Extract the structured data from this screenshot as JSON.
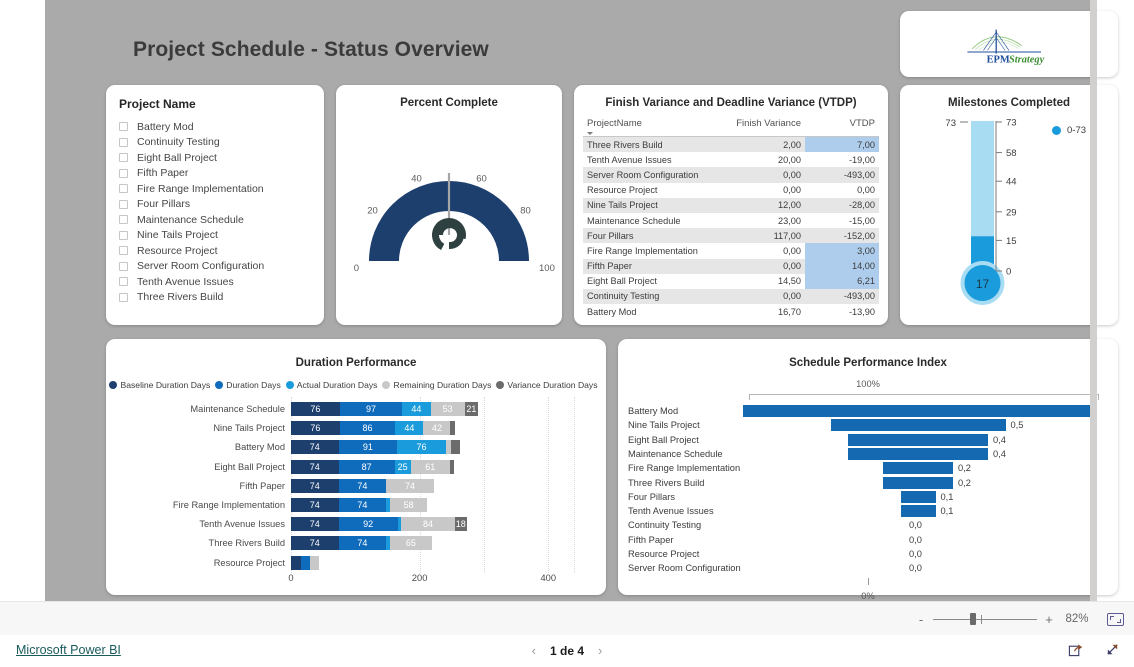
{
  "report": {
    "title": "Project Schedule - Status Overview",
    "logo": {
      "name": "epmstrategy-logo",
      "primary_text": "EPM",
      "secondary_text": "Strategy",
      "primary_color": "#1f4e9c",
      "secondary_color": "#4a9c3f"
    }
  },
  "slicer": {
    "title": "Project Name",
    "items": [
      {
        "label": "Battery Mod",
        "checked": false
      },
      {
        "label": "Continuity Testing",
        "checked": false
      },
      {
        "label": "Eight Ball Project",
        "checked": false
      },
      {
        "label": "Fifth Paper",
        "checked": false
      },
      {
        "label": "Fire Range Implementation",
        "checked": false
      },
      {
        "label": "Four Pillars",
        "checked": false
      },
      {
        "label": "Maintenance Schedule",
        "checked": false
      },
      {
        "label": "Nine Tails Project",
        "checked": false
      },
      {
        "label": "Resource Project",
        "checked": false
      },
      {
        "label": "Server Room Configuration",
        "checked": false
      },
      {
        "label": "Tenth Avenue Issues",
        "checked": false
      },
      {
        "label": "Three Rivers Build",
        "checked": false
      }
    ]
  },
  "table": {
    "title": "Finish Variance and Deadline Variance (VTDP)",
    "columns": [
      "ProjectName",
      "Finish Variance",
      "VTDP"
    ],
    "sorted_column": "ProjectName",
    "highlight_color": "#aecdec",
    "rows": [
      {
        "project": "Three Rivers Build",
        "finish_variance": "2,00",
        "vtdp": "7,00",
        "vtdp_highlight": true
      },
      {
        "project": "Tenth Avenue Issues",
        "finish_variance": "20,00",
        "vtdp": "-19,00",
        "vtdp_highlight": false
      },
      {
        "project": "Server Room Configuration",
        "finish_variance": "0,00",
        "vtdp": "-493,00",
        "vtdp_highlight": false
      },
      {
        "project": "Resource Project",
        "finish_variance": "0,00",
        "vtdp": "0,00",
        "vtdp_highlight": false
      },
      {
        "project": "Nine Tails Project",
        "finish_variance": "12,00",
        "vtdp": "-28,00",
        "vtdp_highlight": false
      },
      {
        "project": "Maintenance Schedule",
        "finish_variance": "23,00",
        "vtdp": "-15,00",
        "vtdp_highlight": false
      },
      {
        "project": "Four Pillars",
        "finish_variance": "117,00",
        "vtdp": "-152,00",
        "vtdp_highlight": false
      },
      {
        "project": "Fire Range Implementation",
        "finish_variance": "0,00",
        "vtdp": "3,00",
        "vtdp_highlight": true
      },
      {
        "project": "Fifth Paper",
        "finish_variance": "0,00",
        "vtdp": "14,00",
        "vtdp_highlight": true
      },
      {
        "project": "Eight Ball Project",
        "finish_variance": "14,50",
        "vtdp": "6,21",
        "vtdp_highlight": true
      },
      {
        "project": "Continuity Testing",
        "finish_variance": "0,00",
        "vtdp": "-493,00",
        "vtdp_highlight": false
      },
      {
        "project": "Battery Mod",
        "finish_variance": "16,70",
        "vtdp": "-13,90",
        "vtdp_highlight": false
      }
    ]
  },
  "chart_data": [
    {
      "id": "percent_complete_gauge",
      "type": "gauge",
      "title": "Percent Complete",
      "value": 50,
      "value_label": "50",
      "min": 0,
      "max": 100,
      "ticks": [
        0,
        20,
        40,
        60,
        80,
        100
      ],
      "tick_labels": [
        "0",
        "20",
        "40",
        "60",
        "80",
        "100"
      ],
      "arc_color": "#1c3f6e",
      "needle_color": "#9a9a9a"
    },
    {
      "id": "milestones_completed_thermometer",
      "type": "thermometer",
      "title": "Milestones Completed",
      "value": 17,
      "value_label": "17",
      "min": 0,
      "max": 73,
      "left_label": "73",
      "ticks": [
        0,
        15,
        29,
        44,
        58,
        73
      ],
      "tick_labels": [
        "0",
        "15",
        "29",
        "44",
        "58",
        "73"
      ],
      "legend": [
        "0-73"
      ],
      "fill_color": "#1a9bdc",
      "track_color": "#a8dcf2"
    },
    {
      "id": "duration_performance",
      "type": "bar",
      "subtype": "stacked-horizontal",
      "title": "Duration Performance",
      "legend_position": "top",
      "series_names": [
        "Baseline Duration Days",
        "Duration Days",
        "Actual Duration Days",
        "Remaining Duration Days",
        "Variance Duration Days"
      ],
      "series_colors": [
        "#1c3f6e",
        "#0f6cbd",
        "#1a9bdc",
        "#c8c8c8",
        "#6b6b6b"
      ],
      "categories": [
        "Maintenance Schedule",
        "Nine Tails Project",
        "Battery Mod",
        "Eight Ball Project",
        "Fifth Paper",
        "Fire Range Implementation",
        "Tenth Avenue Issues",
        "Three Rivers Build",
        "Resource Project"
      ],
      "series": [
        {
          "name": "Baseline Duration Days",
          "values": [
            76,
            76,
            74,
            74,
            74,
            74,
            74,
            74,
            16
          ]
        },
        {
          "name": "Duration Days",
          "values": [
            97,
            86,
            91,
            87,
            74,
            74,
            92,
            74,
            13
          ]
        },
        {
          "name": "Actual Duration Days",
          "values": [
            44,
            44,
            76,
            25,
            0,
            6,
            5,
            6,
            0
          ]
        },
        {
          "name": "Remaining Duration Days",
          "values": [
            53,
            42,
            8,
            61,
            74,
            58,
            84,
            65,
            14
          ]
        },
        {
          "name": "Variance Duration Days",
          "values": [
            21,
            7,
            14,
            7,
            0,
            0,
            18,
            0,
            0
          ]
        }
      ],
      "data_labels": [
        [
          "76",
          "97",
          "44",
          "53",
          "21"
        ],
        [
          "76",
          "86",
          "44",
          "42",
          ""
        ],
        [
          "74",
          "91",
          "76",
          "",
          ""
        ],
        [
          "74",
          "87",
          "25",
          "61",
          ""
        ],
        [
          "74",
          "74",
          "",
          "74",
          ""
        ],
        [
          "74",
          "74",
          "",
          "58",
          ""
        ],
        [
          "74",
          "92",
          "",
          "84",
          "18"
        ],
        [
          "74",
          "74",
          "",
          "65",
          ""
        ],
        [
          "",
          "",
          "",
          "",
          ""
        ]
      ],
      "xlabel": "",
      "ylabel": "",
      "xticks": [
        0,
        200,
        400
      ],
      "xtick_labels": [
        "0",
        "200",
        "400"
      ],
      "xlim": [
        0,
        440
      ],
      "grid": true,
      "has_scrollbar": true
    },
    {
      "id": "schedule_performance_index",
      "type": "funnel",
      "title": "Schedule Performance Index",
      "top_label": "100%",
      "bottom_label": "0%",
      "bar_color": "#1569b0",
      "categories": [
        "Battery Mod",
        "Nine Tails Project",
        "Eight Ball Project",
        "Maintenance Schedule",
        "Fire Range Implementation",
        "Three Rivers Build",
        "Four Pillars",
        "Tenth Avenue Issues",
        "Continuity Testing",
        "Fifth Paper",
        "Resource Project",
        "Server Room Configuration"
      ],
      "values": [
        1.0,
        0.5,
        0.4,
        0.4,
        0.2,
        0.2,
        0.1,
        0.1,
        0.0,
        0.0,
        0.0,
        0.0
      ],
      "value_labels": [
        "",
        "0,5",
        "0,4",
        "0,4",
        "0,2",
        "0,2",
        "0,1",
        "0,1",
        "0,0",
        "0,0",
        "0,0",
        "0,0"
      ]
    }
  ],
  "zoombar": {
    "minus_label": "-",
    "plus_label": "+",
    "zoom_level": "82%",
    "fit_icon": "fit-to-page-icon"
  },
  "statusbar": {
    "brand_link": "Microsoft Power BI",
    "prev_label": "‹",
    "next_label": "›",
    "page_text": "1 de 4",
    "share_icon": "share-icon",
    "fullscreen_icon": "fullscreen-icon"
  }
}
